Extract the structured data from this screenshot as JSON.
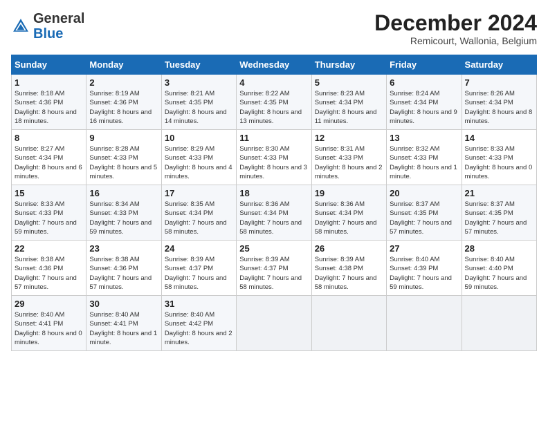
{
  "header": {
    "logo_general": "General",
    "logo_blue": "Blue",
    "month_title": "December 2024",
    "subtitle": "Remicourt, Wallonia, Belgium"
  },
  "days_of_week": [
    "Sunday",
    "Monday",
    "Tuesday",
    "Wednesday",
    "Thursday",
    "Friday",
    "Saturday"
  ],
  "weeks": [
    [
      {
        "day": "1",
        "sunrise": "8:18 AM",
        "sunset": "4:36 PM",
        "daylight": "8 hours and 18 minutes."
      },
      {
        "day": "2",
        "sunrise": "8:19 AM",
        "sunset": "4:36 PM",
        "daylight": "8 hours and 16 minutes."
      },
      {
        "day": "3",
        "sunrise": "8:21 AM",
        "sunset": "4:35 PM",
        "daylight": "8 hours and 14 minutes."
      },
      {
        "day": "4",
        "sunrise": "8:22 AM",
        "sunset": "4:35 PM",
        "daylight": "8 hours and 13 minutes."
      },
      {
        "day": "5",
        "sunrise": "8:23 AM",
        "sunset": "4:34 PM",
        "daylight": "8 hours and 11 minutes."
      },
      {
        "day": "6",
        "sunrise": "8:24 AM",
        "sunset": "4:34 PM",
        "daylight": "8 hours and 9 minutes."
      },
      {
        "day": "7",
        "sunrise": "8:26 AM",
        "sunset": "4:34 PM",
        "daylight": "8 hours and 8 minutes."
      }
    ],
    [
      {
        "day": "8",
        "sunrise": "8:27 AM",
        "sunset": "4:34 PM",
        "daylight": "8 hours and 6 minutes."
      },
      {
        "day": "9",
        "sunrise": "8:28 AM",
        "sunset": "4:33 PM",
        "daylight": "8 hours and 5 minutes."
      },
      {
        "day": "10",
        "sunrise": "8:29 AM",
        "sunset": "4:33 PM",
        "daylight": "8 hours and 4 minutes."
      },
      {
        "day": "11",
        "sunrise": "8:30 AM",
        "sunset": "4:33 PM",
        "daylight": "8 hours and 3 minutes."
      },
      {
        "day": "12",
        "sunrise": "8:31 AM",
        "sunset": "4:33 PM",
        "daylight": "8 hours and 2 minutes."
      },
      {
        "day": "13",
        "sunrise": "8:32 AM",
        "sunset": "4:33 PM",
        "daylight": "8 hours and 1 minute."
      },
      {
        "day": "14",
        "sunrise": "8:33 AM",
        "sunset": "4:33 PM",
        "daylight": "8 hours and 0 minutes."
      }
    ],
    [
      {
        "day": "15",
        "sunrise": "8:33 AM",
        "sunset": "4:33 PM",
        "daylight": "7 hours and 59 minutes."
      },
      {
        "day": "16",
        "sunrise": "8:34 AM",
        "sunset": "4:33 PM",
        "daylight": "7 hours and 59 minutes."
      },
      {
        "day": "17",
        "sunrise": "8:35 AM",
        "sunset": "4:34 PM",
        "daylight": "7 hours and 58 minutes."
      },
      {
        "day": "18",
        "sunrise": "8:36 AM",
        "sunset": "4:34 PM",
        "daylight": "7 hours and 58 minutes."
      },
      {
        "day": "19",
        "sunrise": "8:36 AM",
        "sunset": "4:34 PM",
        "daylight": "7 hours and 58 minutes."
      },
      {
        "day": "20",
        "sunrise": "8:37 AM",
        "sunset": "4:35 PM",
        "daylight": "7 hours and 57 minutes."
      },
      {
        "day": "21",
        "sunrise": "8:37 AM",
        "sunset": "4:35 PM",
        "daylight": "7 hours and 57 minutes."
      }
    ],
    [
      {
        "day": "22",
        "sunrise": "8:38 AM",
        "sunset": "4:36 PM",
        "daylight": "7 hours and 57 minutes."
      },
      {
        "day": "23",
        "sunrise": "8:38 AM",
        "sunset": "4:36 PM",
        "daylight": "7 hours and 57 minutes."
      },
      {
        "day": "24",
        "sunrise": "8:39 AM",
        "sunset": "4:37 PM",
        "daylight": "7 hours and 58 minutes."
      },
      {
        "day": "25",
        "sunrise": "8:39 AM",
        "sunset": "4:37 PM",
        "daylight": "7 hours and 58 minutes."
      },
      {
        "day": "26",
        "sunrise": "8:39 AM",
        "sunset": "4:38 PM",
        "daylight": "7 hours and 58 minutes."
      },
      {
        "day": "27",
        "sunrise": "8:40 AM",
        "sunset": "4:39 PM",
        "daylight": "7 hours and 59 minutes."
      },
      {
        "day": "28",
        "sunrise": "8:40 AM",
        "sunset": "4:40 PM",
        "daylight": "7 hours and 59 minutes."
      }
    ],
    [
      {
        "day": "29",
        "sunrise": "8:40 AM",
        "sunset": "4:41 PM",
        "daylight": "8 hours and 0 minutes."
      },
      {
        "day": "30",
        "sunrise": "8:40 AM",
        "sunset": "4:41 PM",
        "daylight": "8 hours and 1 minute."
      },
      {
        "day": "31",
        "sunrise": "8:40 AM",
        "sunset": "4:42 PM",
        "daylight": "8 hours and 2 minutes."
      },
      null,
      null,
      null,
      null
    ]
  ]
}
